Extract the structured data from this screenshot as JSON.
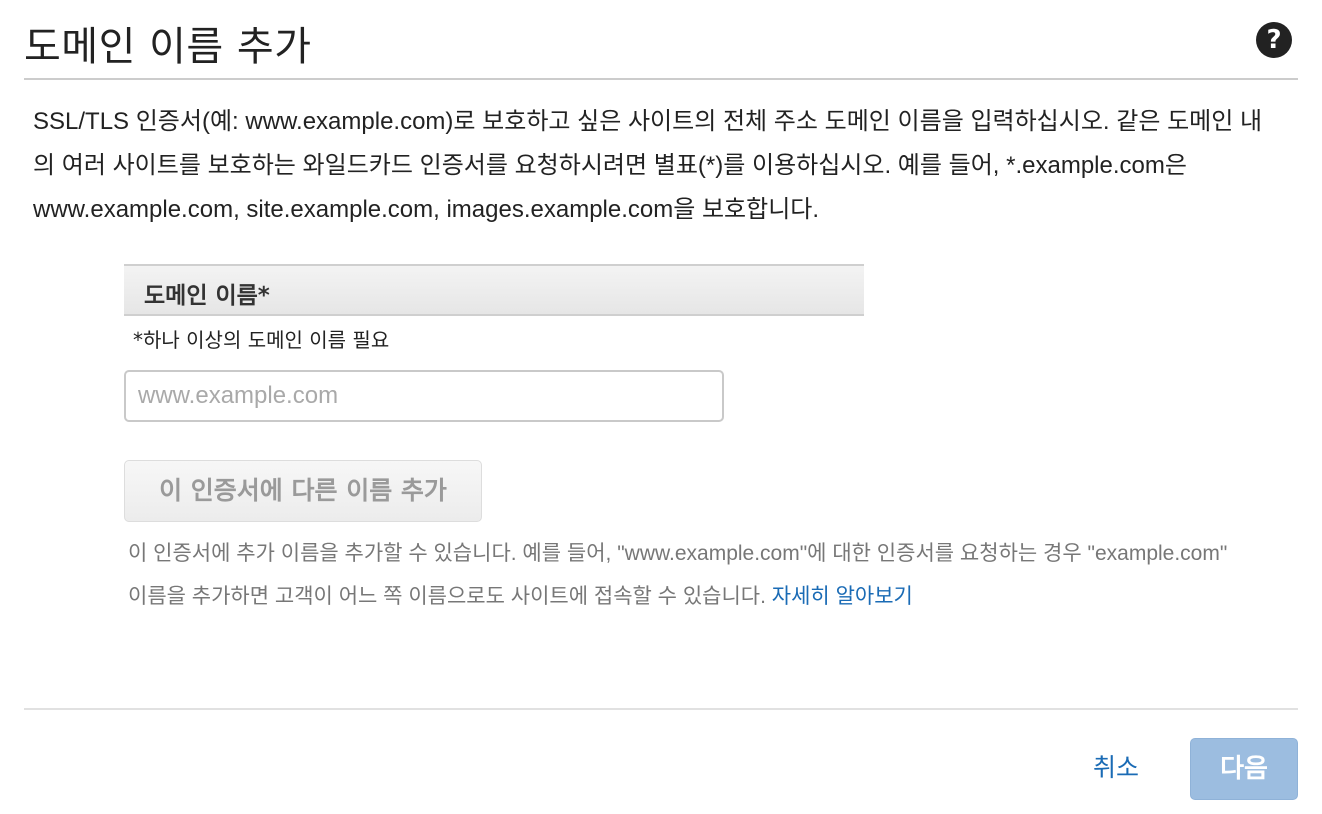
{
  "header": {
    "title": "도메인 이름 추가",
    "help_icon": "question-circle-icon",
    "help_glyph": "?"
  },
  "intro": {
    "text": "SSL/TLS 인증서(예: www.example.com)로 보호하고 싶은 사이트의 전체 주소 도메인 이름을 입력하십시오. 같은 도메인 내의 여러 사이트를 보호하는 와일드카드 인증서를 요청하시려면 별표(*)를 이용하십시오. 예를 들어, *.example.com은 www.example.com, site.example.com, images.example.com을 보호합니다."
  },
  "domain_field": {
    "header_label": "도메인 이름*",
    "required_note": "*하나 이상의 도메인 이름 필요",
    "value": "",
    "placeholder": "www.example.com"
  },
  "add_name_button": {
    "label": "이 인증서에 다른 이름 추가",
    "enabled": false
  },
  "hint": {
    "text": "이 인증서에 추가 이름을 추가할 수 있습니다. 예를 들어, \"www.example.com\"에 대한 인증서를 요청하는 경우 \"example.com\" 이름을 추가하면 고객이 어느 쪽 이름으로도 사이트에 접속할 수 있습니다.",
    "learn_more": "자세히 알아보기"
  },
  "footer": {
    "cancel_label": "취소",
    "next_label": "다음"
  },
  "colors": {
    "link": "#1a6bb5",
    "primary_disabled": "#9cbde0",
    "hint_text": "#777777"
  }
}
